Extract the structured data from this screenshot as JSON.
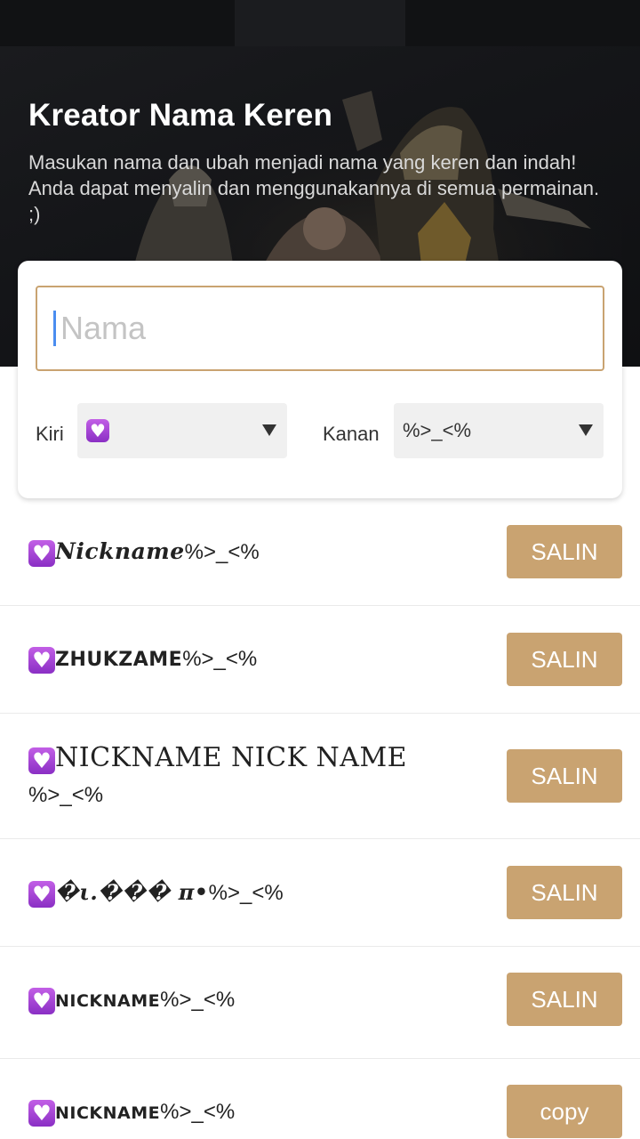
{
  "hero": {
    "title": "Kreator Nama Keren",
    "subtitle": "Masukan nama dan ubah menjadi nama yang keren dan indah! Anda dapat menyalin dan menggunakannya di semua permainan. ;)"
  },
  "form": {
    "name_placeholder": "Nama",
    "name_value": "",
    "left_label": "Kiri",
    "left_selected_icon": "purple-heart-emoji",
    "right_label": "Kanan",
    "right_selected": "%>_<%"
  },
  "colors": {
    "accent": "#c9a371",
    "hero_bg": "#141518",
    "caret": "#4a8df0"
  },
  "results": [
    {
      "nick": "Nickname",
      "suffix": "%>_<%",
      "button": "SALIN"
    },
    {
      "nick": "ZHUKZAME",
      "suffix": "%>_<%",
      "button": "SALIN"
    },
    {
      "nick": "NICKNAME NICK NAME",
      "suffix": "%>_<%",
      "button": "SALIN"
    },
    {
      "nick": "�ι.��� π•",
      "suffix": "%>_<%",
      "button": "SALIN"
    },
    {
      "nick": "NICKNAME",
      "suffix": "%>_<%",
      "button": "SALIN"
    },
    {
      "nick": "NICKNAME",
      "suffix": "%>_<%",
      "button": "copy"
    }
  ]
}
